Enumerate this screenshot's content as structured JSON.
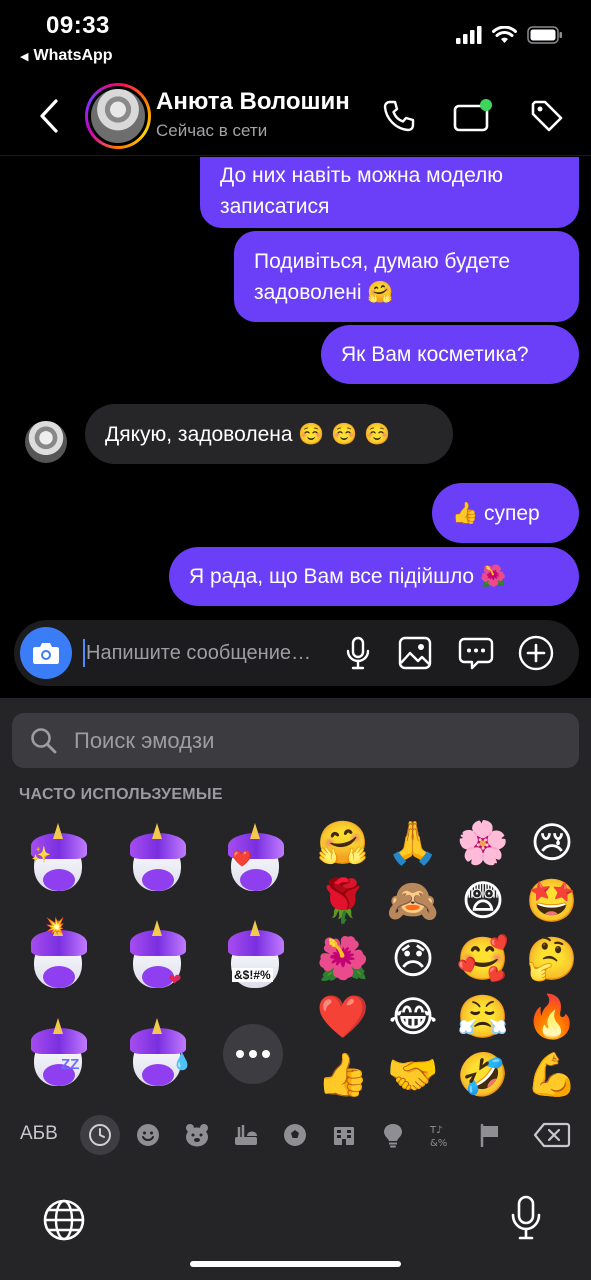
{
  "status_bar": {
    "time": "09:33",
    "back_app": "WhatsApp"
  },
  "header": {
    "name": "Анюта Волошин",
    "status": "Сейчас в сети"
  },
  "messages": [
    {
      "dir": "out",
      "lines": [
        "До них навіть можна моделю",
        "записатися"
      ],
      "emoji": ""
    },
    {
      "dir": "out",
      "lines": [
        "Подивіться, думаю будете",
        "задоволені"
      ],
      "emoji": "🤗"
    },
    {
      "dir": "out",
      "lines": [
        "Як Вам косметика?"
      ],
      "emoji": ""
    },
    {
      "dir": "in",
      "lines": [
        "Дякую, задоволена"
      ],
      "emoji": "☺️ ☺️ ☺️"
    },
    {
      "dir": "out",
      "lines": [
        "супер"
      ],
      "emoji": "👍"
    },
    {
      "dir": "out",
      "lines": [
        "Я рада, що Вам все підійшло"
      ],
      "emoji": "🌺"
    }
  ],
  "composer": {
    "placeholder": "Напишите сообщение…"
  },
  "keyboard": {
    "search_placeholder": "Поиск эмодзи",
    "section_label": "ЧАСТО ИСПОЛЬЗУЕМЫЕ",
    "memoji_stickers": [
      {
        "name": "unicorn-star-eyes",
        "extra": "✨"
      },
      {
        "name": "unicorn-tongue",
        "extra": ""
      },
      {
        "name": "unicorn-heart-eyes",
        "extra": "❤️"
      },
      {
        "name": "unicorn-mind-blown",
        "extra": "💥"
      },
      {
        "name": "unicorn-wink-heart",
        "extra": "❤"
      },
      {
        "name": "unicorn-swearing",
        "extra": "&$!#%"
      },
      {
        "name": "unicorn-sleeping",
        "extra": "ZZ"
      },
      {
        "name": "unicorn-crying-laughing",
        "extra": "💧"
      }
    ],
    "frequent_emoji": [
      [
        "🤗",
        "🙏",
        "🌸",
        "😢"
      ],
      [
        "🌹",
        "🙈",
        "😨",
        "🤩"
      ],
      [
        "🌺",
        "😞",
        "🥰",
        "🤔"
      ],
      [
        "❤️",
        "😂",
        "😤",
        "🔥"
      ],
      [
        "👍",
        "🤝",
        "🤣",
        "💪"
      ]
    ],
    "category_abc": "АБВ",
    "categories": [
      "recent",
      "smileys",
      "animals",
      "food",
      "activity",
      "travel",
      "objects",
      "symbols",
      "flags"
    ]
  },
  "colors": {
    "outgoing_bubble": "#6a3ff7",
    "incoming_bubble": "#262629",
    "camera_button": "#3a7df6",
    "online_dot": "#3ed65a"
  }
}
